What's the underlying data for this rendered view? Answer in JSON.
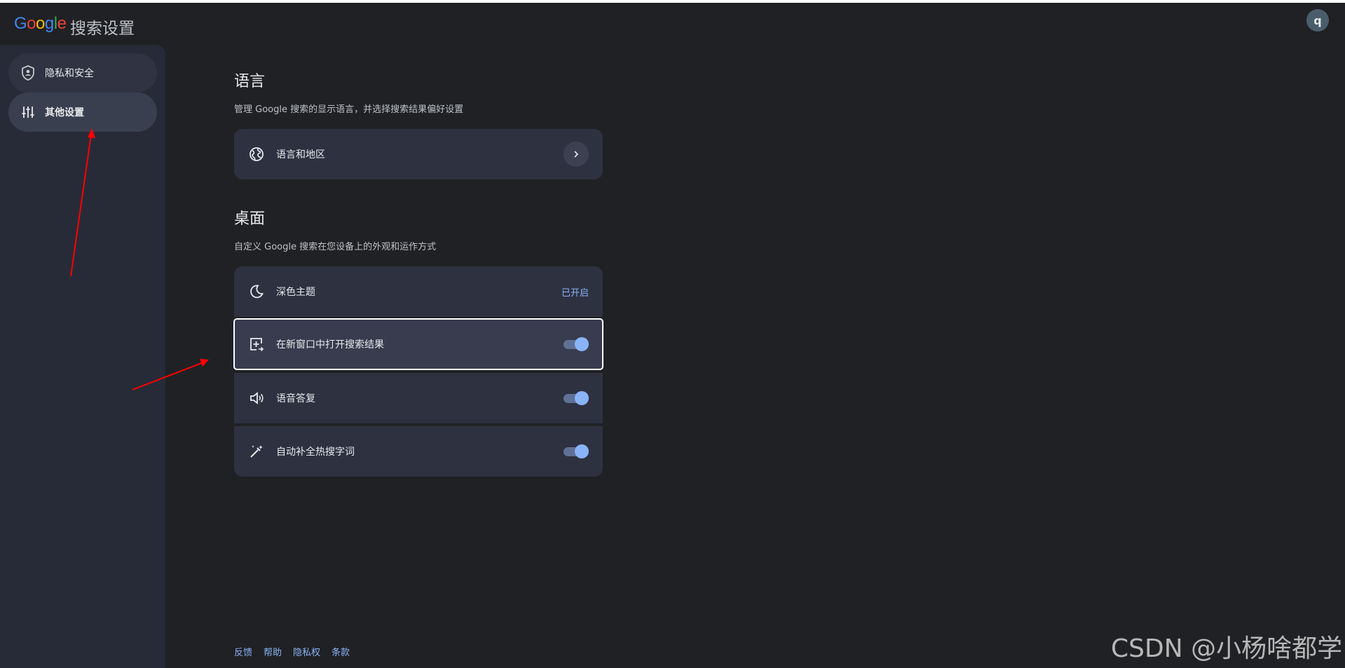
{
  "header": {
    "logo_letters": [
      "G",
      "o",
      "o",
      "g",
      "l",
      "e"
    ],
    "logo_colors": [
      "#4285f4",
      "#ea4335",
      "#fbbc05",
      "#4285f4",
      "#34a853",
      "#ea4335"
    ],
    "title": "搜索设置",
    "avatar_initial": "q"
  },
  "sidebar": {
    "items": [
      {
        "label": "隐私和安全",
        "icon": "shield-icon",
        "active": false
      },
      {
        "label": "其他设置",
        "icon": "sliders-icon",
        "active": true
      }
    ]
  },
  "language_section": {
    "title": "语言",
    "description": "管理 Google 搜索的显示语言，并选择搜索结果偏好设置",
    "rows": [
      {
        "label": "语言和地区",
        "icon": "globe-icon",
        "control": "chevron-right-icon"
      }
    ]
  },
  "desktop_section": {
    "title": "桌面",
    "description": "自定义 Google 搜索在您设备上的外观和运作方式",
    "rows": [
      {
        "label": "深色主题",
        "icon": "moon-icon",
        "status": "已开启"
      },
      {
        "label": "在新窗口中打开搜索结果",
        "icon": "open-in-new-window-icon",
        "toggle_on": true
      },
      {
        "label": "语音答复",
        "icon": "speaker-icon",
        "toggle_on": true
      },
      {
        "label": "自动补全热搜字词",
        "icon": "magic-wand-icon",
        "toggle_on": true
      }
    ]
  },
  "footer": {
    "links": [
      "反馈",
      "帮助",
      "隐私权",
      "条款"
    ]
  },
  "watermark": "CSDN @小杨啥都学",
  "colors": {
    "background": "#202124",
    "sidebar": "#272b37",
    "card": "#2e3140",
    "accent": "#8ab4f8",
    "annotation_arrow": "#ff0000"
  }
}
